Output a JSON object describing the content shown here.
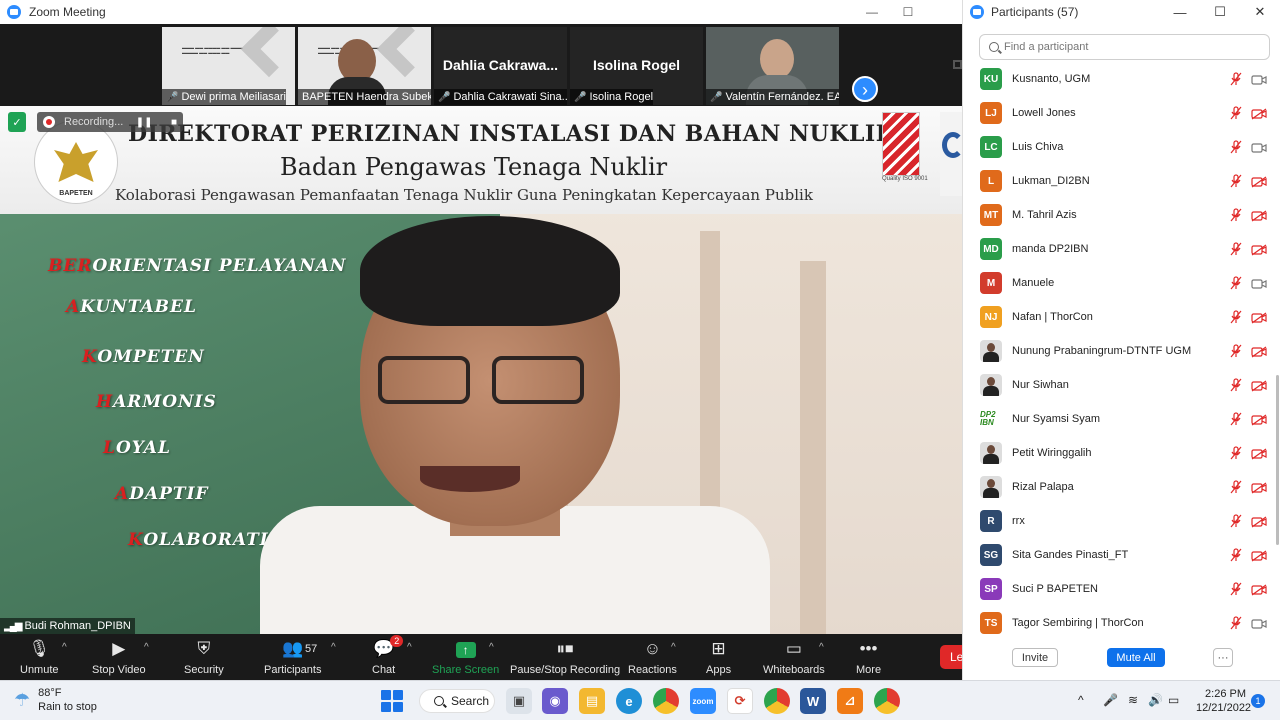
{
  "zoom": {
    "window_title": "Zoom Meeting",
    "thumbnails": [
      {
        "label": "Dewi prima Meiliasari",
        "type": "slide"
      },
      {
        "label": "BAPETEN Haendra Subekti",
        "type": "slide-person"
      },
      {
        "label": "Dahlia Cakrawati Sina...",
        "display_name": "Dahlia  Cakrawa...",
        "type": "name"
      },
      {
        "label": "Isolina Rogel",
        "display_name": "Isolina Rogel",
        "type": "name"
      },
      {
        "label": "Valentín Fernández. EAI",
        "type": "person"
      }
    ],
    "recording_label": "Recording...",
    "speaker_name": "Budi Rohman_DPIBN",
    "slide": {
      "title": "DIREKTORAT PERIZINAN  INSTALASI DAN BAHAN NUKLIR",
      "subtitle": "Badan Pengawas Tenaga Nuklir",
      "tagline": "Kolaborasi Pengawasan Pemanfaatan Tenaga Nuklir Guna Peningkatan Kepercayaan Publik",
      "logo_text": "BAPETEN",
      "cert_text": "Quality ISO 9001",
      "values": [
        {
          "first": "BER",
          "rest": "ORIENTASI PELAYANAN"
        },
        {
          "first": "A",
          "rest": "KUNTABEL"
        },
        {
          "first": "K",
          "rest": "OMPETEN"
        },
        {
          "first": "H",
          "rest": "ARMONIS"
        },
        {
          "first": "L",
          "rest": "OYAL"
        },
        {
          "first": "A",
          "rest": "DAPTIF"
        },
        {
          "first": "K",
          "rest": "OLABORATIF"
        }
      ]
    },
    "toolbar": {
      "unmute": "Unmute",
      "stop_video": "Stop Video",
      "security": "Security",
      "participants": "Participants",
      "participants_count": "57",
      "chat": "Chat",
      "chat_badge": "2",
      "share_screen": "Share Screen",
      "pause_stop_recording": "Pause/Stop Recording",
      "reactions": "Reactions",
      "apps": "Apps",
      "whiteboards": "Whiteboards",
      "more": "More",
      "leave": "Le"
    }
  },
  "participants_panel": {
    "title": "Participants (57)",
    "search_placeholder": "Find a participant",
    "participants": [
      {
        "initials": "KU",
        "name": "Kusnanto, UGM",
        "color": "#2a9d4a",
        "video": "on"
      },
      {
        "initials": "LJ",
        "name": "Lowell Jones",
        "color": "#e06a1b",
        "video": "off"
      },
      {
        "initials": "LC",
        "name": "Luis Chiva",
        "color": "#2a9d4a",
        "video": "on"
      },
      {
        "initials": "L",
        "name": "Lukman_DI2BN",
        "color": "#e06a1b",
        "video": "off"
      },
      {
        "initials": "MT",
        "name": "M. Tahril Azis",
        "color": "#e06a1b",
        "video": "off"
      },
      {
        "initials": "MD",
        "name": "manda DP2IBN",
        "color": "#2a9d4a",
        "video": "off"
      },
      {
        "initials": "M",
        "name": "Manuele",
        "color": "#d23c2c",
        "video": "on"
      },
      {
        "initials": "NJ",
        "name": "Nafan | ThorCon",
        "color": "#f0a020",
        "video": "off"
      },
      {
        "initials": "",
        "name": "Nunung Prabaningrum-DTNTF UGM",
        "color": "photo",
        "video": "off"
      },
      {
        "initials": "",
        "name": "Nur Siwhan",
        "color": "photo",
        "video": "off"
      },
      {
        "initials": "DP2 IBN",
        "name": "Nur Syamsi Syam",
        "color": "logo",
        "video": "off"
      },
      {
        "initials": "",
        "name": "Petit Wiringgalih",
        "color": "photo",
        "video": "off"
      },
      {
        "initials": "",
        "name": "Rizal Palapa",
        "color": "photo",
        "video": "off"
      },
      {
        "initials": "R",
        "name": "rrx",
        "color": "#2f4a6e",
        "video": "off"
      },
      {
        "initials": "SG",
        "name": "Sita Gandes Pinasti_FT",
        "color": "#2f4a6e",
        "video": "off"
      },
      {
        "initials": "SP",
        "name": "Suci P BAPETEN",
        "color": "#8a3ab9",
        "video": "off"
      },
      {
        "initials": "TS",
        "name": "Tagor Sembiring | ThorCon",
        "color": "#e06a1b",
        "video": "on"
      }
    ],
    "invite": "Invite",
    "mute_all": "Mute All",
    "more": "···"
  },
  "taskbar": {
    "weather_temp": "88°F",
    "weather_desc": "Rain to stop",
    "search": "Search",
    "time": "2:26 PM",
    "date": "12/21/2022",
    "notification_count": "1"
  },
  "colors": {
    "zoom_blue": "#2d8cff",
    "accent_red": "#e02828",
    "share_green": "#1fa355",
    "mute_all_blue": "#0e71eb"
  }
}
